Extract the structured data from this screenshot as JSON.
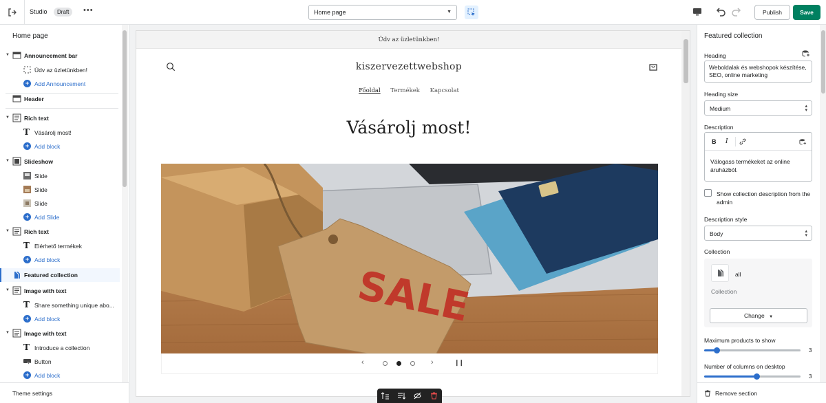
{
  "topbar": {
    "app_name": "Studio",
    "status_badge": "Draft",
    "more_label": "•••",
    "page_select": "Home page",
    "publish_label": "Publish",
    "save_label": "Save"
  },
  "sidebar": {
    "title": "Home page",
    "items": [
      {
        "label": "Announcement bar"
      },
      {
        "label": "Üdv az üzletünkben!"
      },
      {
        "label": "Add Announcement"
      },
      {
        "label": "Header"
      },
      {
        "label": "Rich text"
      },
      {
        "label": "Vásárolj most!"
      },
      {
        "label": "Add block"
      },
      {
        "label": "Slideshow"
      },
      {
        "label": "Slide"
      },
      {
        "label": "Slide"
      },
      {
        "label": "Slide"
      },
      {
        "label": "Add Slide"
      },
      {
        "label": "Rich text"
      },
      {
        "label": "Elérhető termékek"
      },
      {
        "label": "Add block"
      },
      {
        "label": "Featured collection"
      },
      {
        "label": "Image with text"
      },
      {
        "label": "Share something unique abo..."
      },
      {
        "label": "Add block"
      },
      {
        "label": "Image with text"
      },
      {
        "label": "Introduce a collection"
      },
      {
        "label": "Button"
      },
      {
        "label": "Add block"
      }
    ],
    "footer_label": "Theme settings"
  },
  "preview": {
    "announcement": "Üdv az üzletünkben!",
    "logo": "kiszervezettwebshop",
    "nav": [
      "Főoldal",
      "Termékek",
      "Kapcsolat"
    ],
    "heading": "Vásárolj most!",
    "image_text": "SALE",
    "slides_total": 3,
    "active_slide": 2
  },
  "settings": {
    "title": "Featured collection",
    "heading_label": "Heading",
    "heading_value": "Weboldalak és webshopok készítése, SEO, online marketing",
    "heading_size_label": "Heading size",
    "heading_size_value": "Medium",
    "description_label": "Description",
    "description_value": "Válogass termékeket az online áruházból.",
    "show_desc_label": "Show collection description from the admin",
    "show_desc_checked": false,
    "desc_style_label": "Description style",
    "desc_style_value": "Body",
    "collection_label": "Collection",
    "collection_value": "all",
    "collection_caption": "Collection",
    "change_label": "Change",
    "max_products_label": "Maximum products to show",
    "max_products_value": "3",
    "columns_label": "Number of columns on desktop",
    "columns_value": "3",
    "remove_label": "Remove section"
  },
  "colors": {
    "accent": "#2c6ecb",
    "save": "#008060"
  }
}
